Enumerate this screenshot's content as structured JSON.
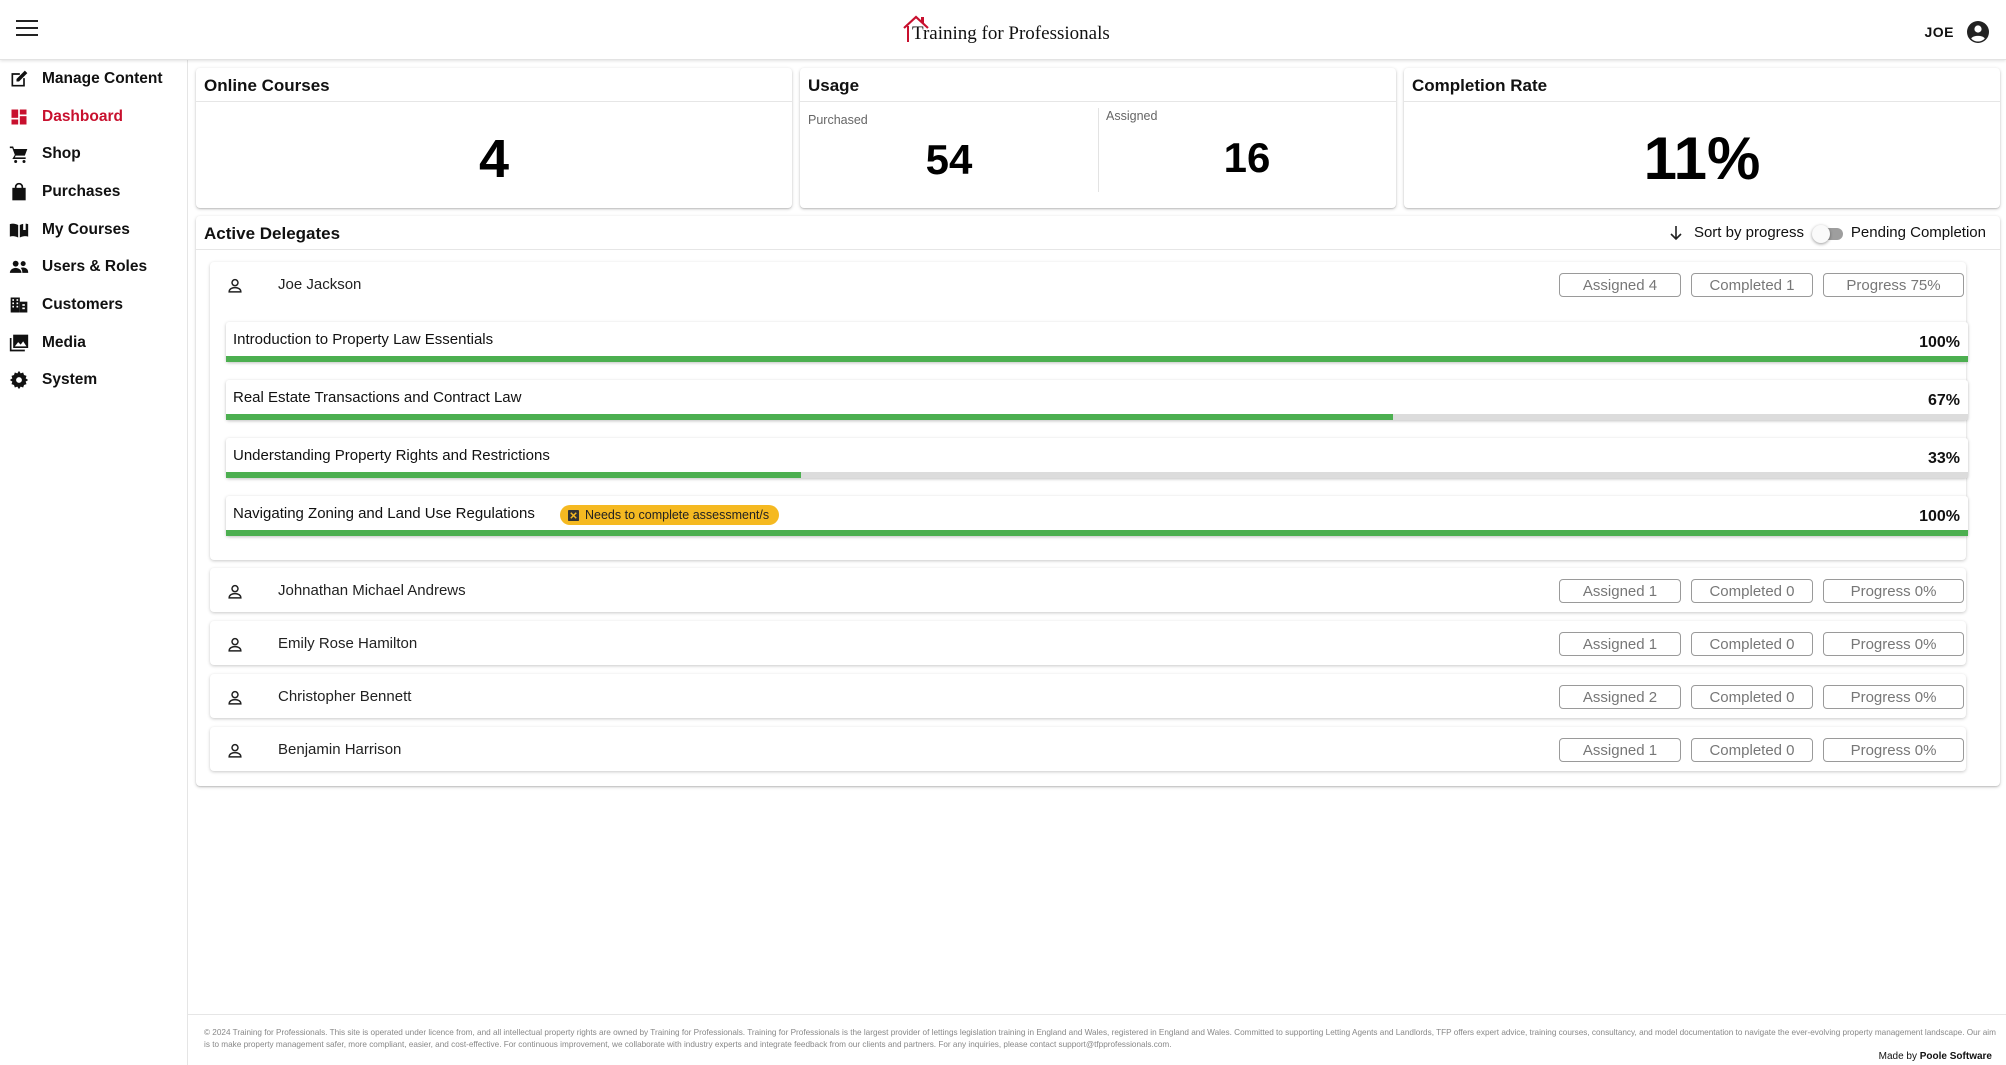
{
  "header": {
    "brand": "Training for Professionals",
    "user": "JOE"
  },
  "sidebar": {
    "items": [
      {
        "label": "Manage Content",
        "icon": "edit-icon",
        "active": false
      },
      {
        "label": "Dashboard",
        "icon": "dashboard-icon",
        "active": true
      },
      {
        "label": "Shop",
        "icon": "cart-icon",
        "active": false
      },
      {
        "label": "Purchases",
        "icon": "bag-icon",
        "active": false
      },
      {
        "label": "My Courses",
        "icon": "book-icon",
        "active": false
      },
      {
        "label": "Users & Roles",
        "icon": "people-icon",
        "active": false
      },
      {
        "label": "Customers",
        "icon": "building-icon",
        "active": false
      },
      {
        "label": "Media",
        "icon": "media-icon",
        "active": false
      },
      {
        "label": "System",
        "icon": "gear-icon",
        "active": false
      }
    ]
  },
  "stats": {
    "online_courses": {
      "title": "Online Courses",
      "value": "4"
    },
    "usage": {
      "title": "Usage",
      "purchased_label": "Purchased",
      "purchased": "54",
      "assigned_label": "Assigned",
      "assigned": "16"
    },
    "completion": {
      "title": "Completion Rate",
      "value": "11%"
    }
  },
  "delegates": {
    "title": "Active Delegates",
    "sort_label": "Sort by progress",
    "toggle_label": "Pending Completion",
    "rows": [
      {
        "name": "Joe Jackson",
        "assigned": "Assigned 4",
        "completed": "Completed 1",
        "progress": "Progress 75%",
        "courses": [
          {
            "name": "Introduction to Property Law Essentials",
            "pct": "100%",
            "value": 100,
            "badge": ""
          },
          {
            "name": "Real Estate Transactions and Contract Law",
            "pct": "67%",
            "value": 67,
            "badge": ""
          },
          {
            "name": "Understanding Property Rights and Restrictions",
            "pct": "33%",
            "value": 33,
            "badge": ""
          },
          {
            "name": "Navigating Zoning and Land Use Regulations",
            "pct": "100%",
            "value": 100,
            "badge": "Needs to complete assessment/s"
          }
        ]
      },
      {
        "name": "Johnathan Michael Andrews",
        "assigned": "Assigned 1",
        "completed": "Completed 0",
        "progress": "Progress 0%"
      },
      {
        "name": "Emily Rose Hamilton",
        "assigned": "Assigned 1",
        "completed": "Completed 0",
        "progress": "Progress 0%"
      },
      {
        "name": "Christopher Bennett",
        "assigned": "Assigned 2",
        "completed": "Completed 0",
        "progress": "Progress 0%"
      },
      {
        "name": "Benjamin Harrison",
        "assigned": "Assigned 1",
        "completed": "Completed 0",
        "progress": "Progress 0%"
      }
    ]
  },
  "footer": {
    "text": "© 2024 Training for Professionals. This site is operated under licence from, and all intellectual property rights are owned by Training for Professionals. Training for Professionals is the largest provider of lettings legislation training in England and Wales, registered in England and Wales. Committed to supporting Letting Agents and Landlords, TFP offers expert advice, training courses, consultancy, and model documentation to navigate the ever-evolving property management landscape. Our aim is to make property management safer, more compliant, easier, and cost-effective. For continuous improvement, we collaborate with industry experts and integrate feedback from our clients and partners. For any inquiries, please contact support@tfpprofessionals.com.",
    "made_by_prefix": "Made by",
    "made_by_name": "Poole Software"
  },
  "colors": {
    "accent": "#c8102e",
    "progress": "#4caf50",
    "badge": "#f5b921"
  }
}
